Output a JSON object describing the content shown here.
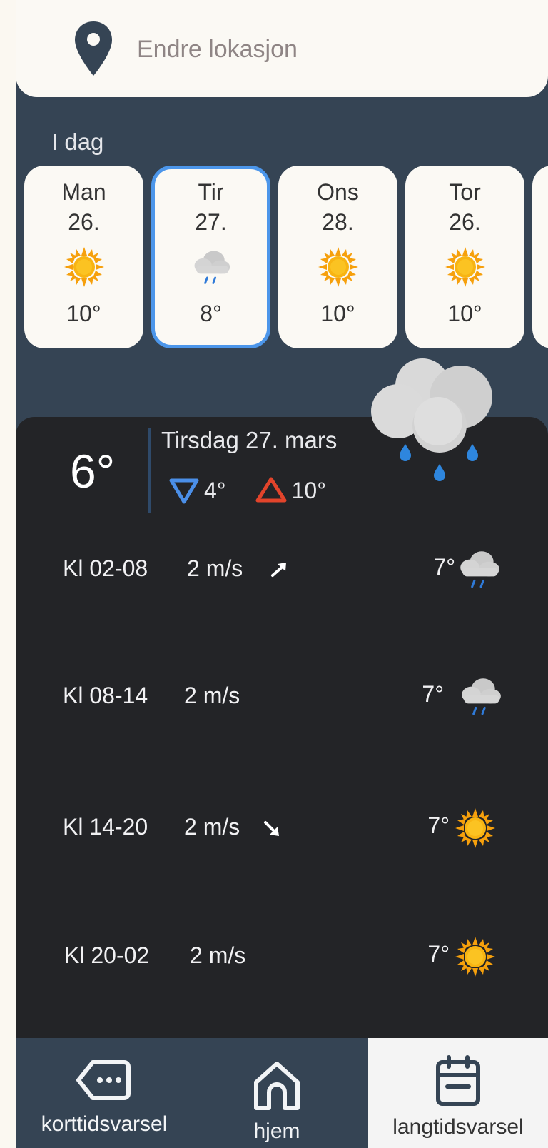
{
  "location_bar": {
    "label": "Endre lokasjon"
  },
  "today_label": "I dag",
  "days": [
    {
      "name": "Man",
      "date": "26.",
      "icon": "sun-icon",
      "temp": "10°"
    },
    {
      "name": "Tir",
      "date": "27.",
      "icon": "rain-cloud-icon",
      "temp": "8°",
      "selected": true
    },
    {
      "name": "Ons",
      "date": "28.",
      "icon": "sun-icon",
      "temp": "10°"
    },
    {
      "name": "Tor",
      "date": "26.",
      "icon": "sun-icon",
      "temp": "10°"
    }
  ],
  "detail": {
    "current_temp": "6°",
    "day_label": "Tirsdag 27. mars",
    "min_temp": "4°",
    "max_temp": "10°",
    "icon": "rain-cloud-icon",
    "periods": [
      {
        "time": "Kl 02-08",
        "wind": "2 m/s",
        "wind_dir": "northeast-arrow-icon",
        "temp": "7°",
        "icon": "rain-cloud-icon"
      },
      {
        "time": "Kl 08-14",
        "wind": "2 m/s",
        "wind_dir": "",
        "temp": "7°",
        "icon": "rain-cloud-icon"
      },
      {
        "time": "Kl 14-20",
        "wind": "2 m/s",
        "wind_dir": "southeast-arrow-icon",
        "temp": "7°",
        "icon": "sun-icon"
      },
      {
        "time": "Kl 20-02",
        "wind": "2 m/s",
        "wind_dir": "",
        "temp": "7°",
        "icon": "sun-icon"
      }
    ]
  },
  "nav": [
    {
      "label": "korttidsvarsel",
      "icon": "message-dots-icon",
      "active": false
    },
    {
      "label": "hjem",
      "icon": "home-icon",
      "active": false
    },
    {
      "label": "langtidsvarsel",
      "icon": "calendar-icon",
      "active": true
    }
  ],
  "colors": {
    "panel": "#232427",
    "header": "#354454",
    "selected_border": "#4c96ea",
    "min_arrow": "#4b8fe8",
    "max_arrow": "#e2442b",
    "sun": "#f6a10b"
  }
}
